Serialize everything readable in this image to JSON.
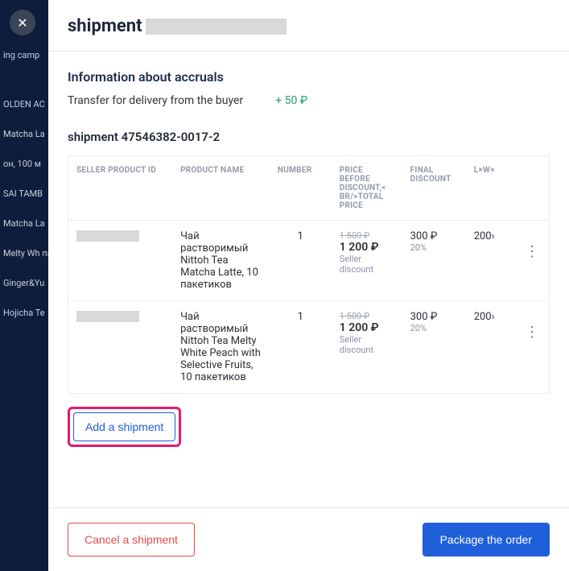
{
  "header": {
    "title": "shipment"
  },
  "bg": {
    "items": [
      "ing camp",
      "",
      "OLDEN AC",
      "Matcha La",
      "oн, 100 м",
      "SAI TAMB",
      "Matcha La",
      "Melty Wh пакетико",
      "Ginger&Yu",
      "Hojicha Te"
    ]
  },
  "accruals": {
    "title": "Information about accruals",
    "transfer_label": "Transfer for delivery from the buyer",
    "transfer_value": "+ 50 ₽"
  },
  "shipment": {
    "title": "shipment 47546382-0017-2",
    "columns": {
      "seller_id": "SELLER PRODUCT ID",
      "product_name": "PRODUCT NAME",
      "number": "NUMBER",
      "price": "PRICE BEFORE DISCOUNT,< BR/>TOTAL PRICE",
      "discount": "FINAL DISCOUNT",
      "lwx": "L×W×"
    },
    "rows": [
      {
        "name": "Чай растворимый Nittoh Tea Matcha Latte, 10 пакетиков",
        "qty": "1",
        "price_strike": "1 500 ₽",
        "price_main": "1 200 ₽",
        "price_sub": "Seller discount",
        "disc_amount": "300 ₽",
        "disc_pct": "20%",
        "lwx": "200›"
      },
      {
        "name": "Чай растворимый Nittoh Tea Melty White Peach with Selective Fruits, 10 пакетиков",
        "qty": "1",
        "price_strike": "1 500 ₽",
        "price_main": "1 200 ₽",
        "price_sub": "Seller discount",
        "disc_amount": "300 ₽",
        "disc_pct": "20%",
        "lwx": "200›"
      }
    ]
  },
  "buttons": {
    "add_shipment": "Add a shipment",
    "cancel": "Cancel a shipment",
    "package": "Package the order"
  }
}
